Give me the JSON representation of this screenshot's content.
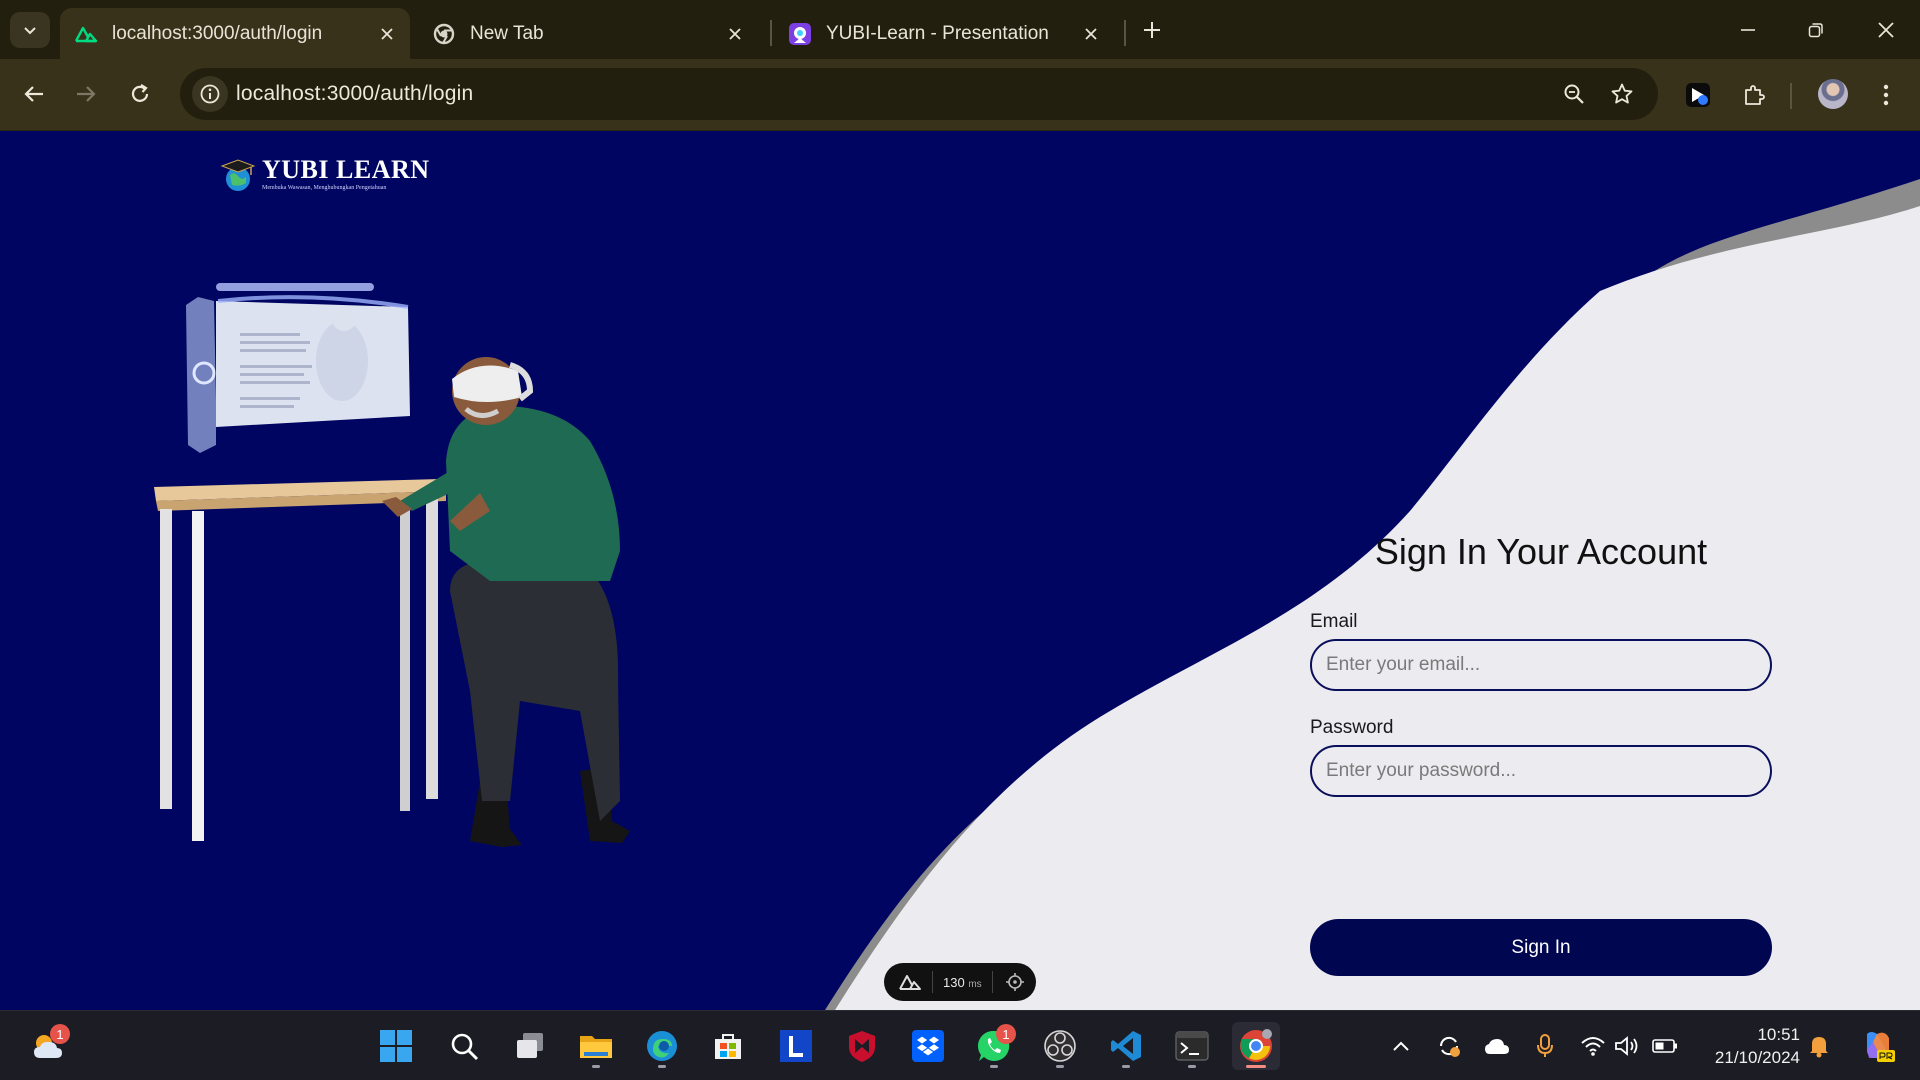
{
  "browser": {
    "tabs": [
      {
        "title": "localhost:3000/auth/login",
        "favicon": "nuxt-icon",
        "active": true
      },
      {
        "title": "New Tab",
        "favicon": "chrome-icon",
        "active": false
      },
      {
        "title": "YUBI-Learn - Presentation",
        "favicon": "canva-icon",
        "active": false
      }
    ],
    "address_bar": {
      "url": "localhost:3000/auth/login"
    }
  },
  "page": {
    "logo": {
      "name": "YUBI LEARN",
      "tagline": "Membuka Wawasan, Menghubungkan Pengetahuan"
    },
    "login": {
      "title": "Sign In Your Account",
      "email_label": "Email",
      "email_placeholder": "Enter your email...",
      "password_label": "Password",
      "password_placeholder": "Enter your password...",
      "submit_label": "Sign In"
    },
    "devtools": {
      "time_value": "130",
      "time_unit": "ms"
    }
  },
  "colors": {
    "brand_navy": "#000561",
    "panel_light": "#ececf0",
    "curve_shadow": "#8c8c8c"
  },
  "taskbar": {
    "weather_badge": "1",
    "whatsapp_badge": "1",
    "apps": [
      "start-icon",
      "search-icon",
      "task-view-icon",
      "file-explorer-icon",
      "edge-icon",
      "microsoft-store-icon",
      "l-app-icon",
      "mcafee-icon",
      "dropbox-icon",
      "whatsapp-icon",
      "obs-icon",
      "vscode-icon",
      "terminal-icon",
      "chrome-icon"
    ],
    "clock": {
      "time": "10:51",
      "date": "21/10/2024"
    }
  }
}
